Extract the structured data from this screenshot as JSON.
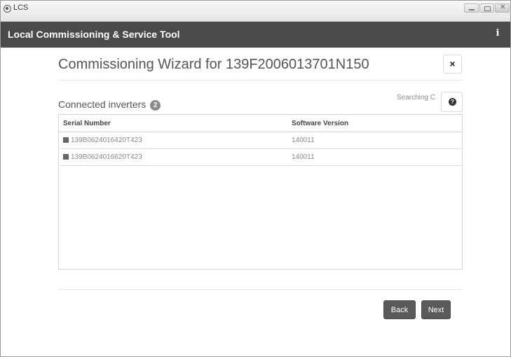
{
  "window": {
    "os_title": "LCS",
    "icons": {
      "logo": "lcs-logo-icon",
      "minimize": "minimize-icon",
      "maximize": "maximize-icon",
      "close": "window-close-icon"
    }
  },
  "app": {
    "title": "Local Commissioning & Service Tool",
    "info_icon": "i"
  },
  "wizard": {
    "title": "Commissioning Wizard for 139F2006013701N150",
    "close_icon": "×",
    "section_label": "Connected inverters",
    "inverter_count": "2",
    "status_text": "Searching C",
    "help_icon": "?",
    "table": {
      "columns": [
        "Serial Number",
        "Software Version"
      ],
      "rows": [
        {
          "serial": "139B0624016420T423",
          "software_version": "140011"
        },
        {
          "serial": "139B0624016620T423",
          "software_version": "140011"
        }
      ]
    },
    "buttons": {
      "back": "Back",
      "next": "Next"
    }
  }
}
